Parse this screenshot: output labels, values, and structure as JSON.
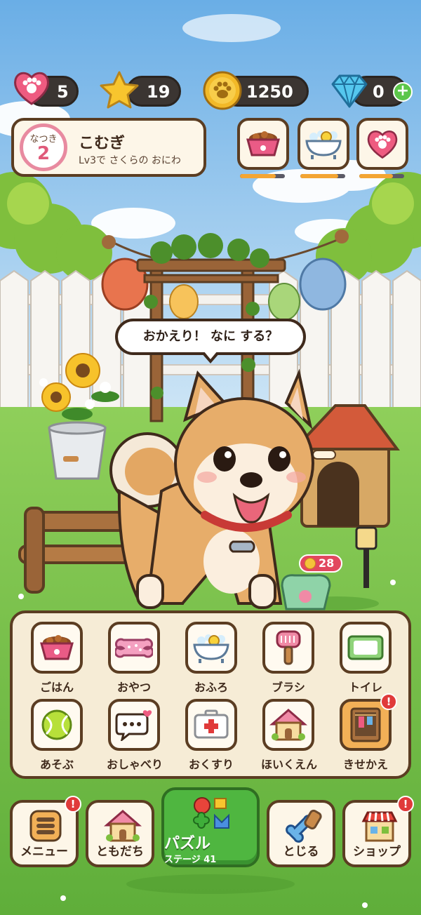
{
  "hud": {
    "hearts": "5",
    "stars": "19",
    "coins": "1250",
    "gems": "0",
    "plus": "+"
  },
  "pet": {
    "bond_label": "なつき",
    "bond_level": "2",
    "name": "こむぎ",
    "subtitle": "Lv3で さくらの おにわ"
  },
  "needs": [
    {
      "icon": "food-bowl-icon",
      "level": 0.8
    },
    {
      "icon": "bathtub-icon",
      "level": 0.85
    },
    {
      "icon": "heart-paw-icon",
      "level": 0.75
    }
  ],
  "speech": "おかえり！ なに する？",
  "treat_bag_count": "28",
  "actions": [
    {
      "label": "ごはん",
      "icon": "food-bowl-icon"
    },
    {
      "label": "おやつ",
      "icon": "bone-treat-icon"
    },
    {
      "label": "おふろ",
      "icon": "bathtub-icon"
    },
    {
      "label": "ブラシ",
      "icon": "brush-icon"
    },
    {
      "label": "トイレ",
      "icon": "toilet-pad-icon"
    },
    {
      "label": "あそぶ",
      "icon": "tennis-ball-icon"
    },
    {
      "label": "おしゃべり",
      "icon": "chat-bubble-icon"
    },
    {
      "label": "おくすり",
      "icon": "first-aid-kit-icon"
    },
    {
      "label": "ほいくえん",
      "icon": "daycare-house-icon"
    },
    {
      "label": "きせかえ",
      "icon": "wardrobe-icon"
    }
  ],
  "alert_mark": "!",
  "nav": {
    "menu": "メニュー",
    "friends": "ともだち",
    "puzzle": "パズル",
    "puzzle_stage": "ステージ 41",
    "close": "とじる",
    "shop": "ショップ"
  },
  "colors": {
    "frame_brown": "#5b3d22",
    "panel_cream": "#f6ecd6",
    "puzzle_green": "#4fb640",
    "alert_red": "#e03a3a",
    "bond_pink": "#e88aa0"
  }
}
